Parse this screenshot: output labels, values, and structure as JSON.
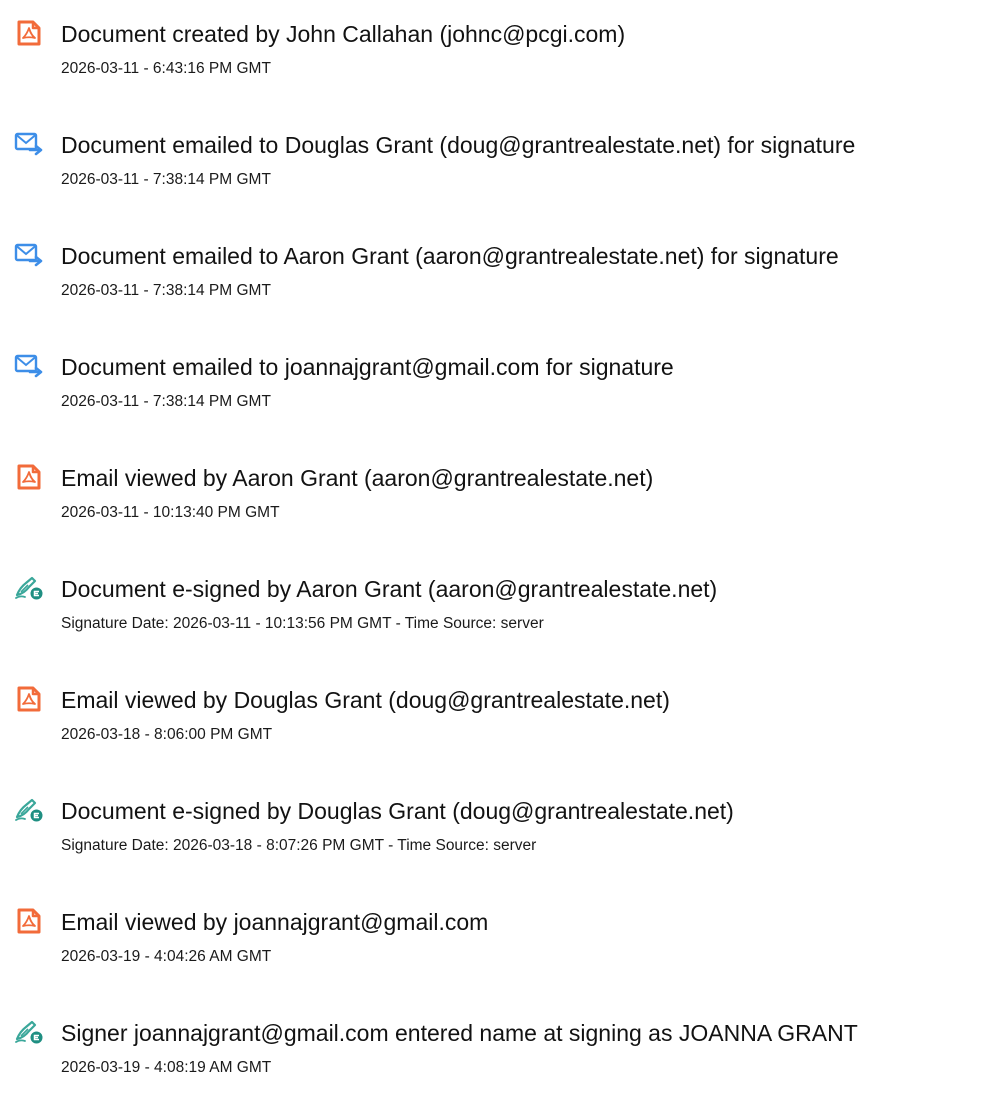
{
  "events": [
    {
      "icon": "pdf-document-icon",
      "title": "Document created by John Callahan (johnc@pcgi.com)",
      "detail": "2026-03-11 - 6:43:16 PM GMT"
    },
    {
      "icon": "email-sent-icon",
      "title": "Document emailed to Douglas Grant (doug@grantrealestate.net) for signature",
      "detail": "2026-03-11 - 7:38:14 PM GMT"
    },
    {
      "icon": "email-sent-icon",
      "title": "Document emailed to Aaron Grant (aaron@grantrealestate.net) for signature",
      "detail": "2026-03-11 - 7:38:14 PM GMT"
    },
    {
      "icon": "email-sent-icon",
      "title": "Document emailed to joannajgrant@gmail.com for signature",
      "detail": "2026-03-11 - 7:38:14 PM GMT"
    },
    {
      "icon": "pdf-document-icon",
      "title": "Email viewed by Aaron Grant (aaron@grantrealestate.net)",
      "detail": "2026-03-11 - 10:13:40 PM GMT"
    },
    {
      "icon": "e-sign-pen-icon",
      "title": "Document e-signed by Aaron Grant (aaron@grantrealestate.net)",
      "detail": "Signature Date: 2026-03-11 - 10:13:56 PM GMT - Time Source: server"
    },
    {
      "icon": "pdf-document-icon",
      "title": "Email viewed by Douglas Grant (doug@grantrealestate.net)",
      "detail": "2026-03-18 - 8:06:00 PM GMT"
    },
    {
      "icon": "e-sign-pen-icon",
      "title": "Document e-signed by Douglas Grant (doug@grantrealestate.net)",
      "detail": "Signature Date: 2026-03-18 - 8:07:26 PM GMT - Time Source: server"
    },
    {
      "icon": "pdf-document-icon",
      "title": "Email viewed by joannajgrant@gmail.com",
      "detail": "2026-03-19 - 4:04:26 AM GMT"
    },
    {
      "icon": "e-sign-pen-icon",
      "title": "Signer joannajgrant@gmail.com entered name at signing as JOANNA GRANT",
      "detail": "2026-03-19 - 4:08:19 AM GMT"
    }
  ],
  "colors": {
    "pdf_icon": "#f26b3a",
    "email_icon": "#3d8ee8",
    "esign_pen": "#3aa79a",
    "esign_badge": "#1f8f82"
  }
}
